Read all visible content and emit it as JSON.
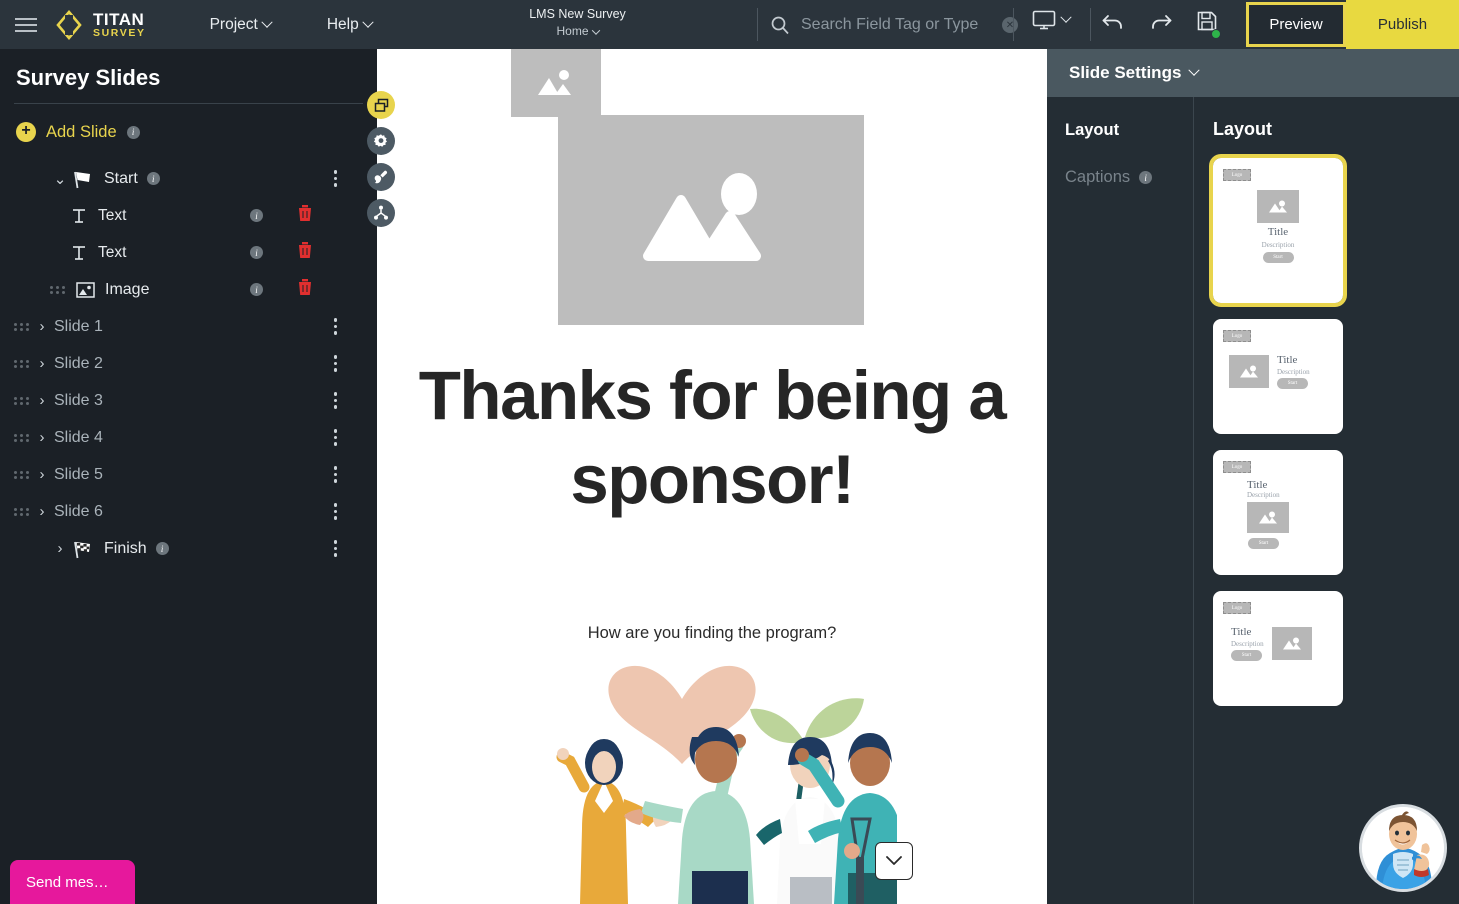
{
  "topbar": {
    "menu_icon": "hamburger-icon",
    "brand_primary": "TITAN",
    "brand_secondary": "SURVEY",
    "menus": [
      {
        "label": "Project"
      },
      {
        "label": "Help"
      }
    ],
    "doc_title": "LMS New Survey",
    "doc_subtitle": "Home",
    "search": {
      "placeholder": "Search Field Tag or Type",
      "value": "",
      "clear_label": "✕"
    },
    "device_icon": "monitor-icon",
    "undo_icon": "undo-icon",
    "redo_icon": "redo-icon",
    "save_icon": "save-icon",
    "preview_label": "Preview",
    "publish_label": "Publish",
    "accent_color": "#e8d44d"
  },
  "sidebar": {
    "title": "Survey Slides",
    "add_slide_label": "Add Slide",
    "info_char": "i",
    "tree": [
      {
        "label": "Start",
        "icon": "flag-icon",
        "expanded": true,
        "info": true
      },
      {
        "label": "Text",
        "icon": "text-icon",
        "child": true,
        "info": true
      },
      {
        "label": "Text",
        "icon": "text-icon",
        "child": true,
        "info": true
      },
      {
        "label": "Image",
        "icon": "image-icon",
        "child": true,
        "info": true
      },
      {
        "label": "Slide 1",
        "icon": "none",
        "expanded": false
      },
      {
        "label": "Slide 2",
        "icon": "none",
        "expanded": false
      },
      {
        "label": "Slide 3",
        "icon": "none",
        "expanded": false
      },
      {
        "label": "Slide 4",
        "icon": "none",
        "expanded": false
      },
      {
        "label": "Slide 5",
        "icon": "none",
        "expanded": false
      },
      {
        "label": "Slide 6",
        "icon": "none",
        "expanded": false
      },
      {
        "label": "Finish",
        "icon": "checkered-flag-icon",
        "expanded": false,
        "info": true
      }
    ],
    "fabs": [
      {
        "name": "duplicate-icon",
        "accent": true
      },
      {
        "name": "gear-icon",
        "accent": false
      },
      {
        "name": "brush-icon",
        "accent": false
      },
      {
        "name": "branch-icon",
        "accent": false
      }
    ],
    "chat_label": "Send mes…",
    "chat_color": "#e6189c"
  },
  "canvas": {
    "logo_placeholder": "image-placeholder",
    "main_placeholder": "image-placeholder",
    "headline": "Thanks for being a sponsor!",
    "subline": "How are you finding the program?",
    "illustration": "people-celebrating-illustration",
    "scroll_down_icon": "chevron-down-icon"
  },
  "right_panel": {
    "header": "Slide Settings",
    "nav": [
      {
        "label": "Layout",
        "active": true,
        "info": false
      },
      {
        "label": "Captions",
        "active": false,
        "info": true
      }
    ],
    "section_title": "Layout",
    "thumbs": [
      {
        "name": "layout-centered",
        "selected": true,
        "logo": "Logo",
        "title": "Title",
        "description": "Description",
        "start": "Start"
      },
      {
        "name": "layout-image-left",
        "selected": false,
        "logo": "Logo",
        "title": "Title",
        "description": "Description",
        "start": "Start"
      },
      {
        "name": "layout-text-above-image",
        "selected": false,
        "logo": "Logo",
        "title": "Title",
        "description": "Description",
        "start": "Start"
      },
      {
        "name": "layout-image-right",
        "selected": false,
        "logo": "Logo",
        "title": "Title",
        "description": "Description",
        "start": "Start"
      }
    ]
  },
  "helper_bot": {
    "name": "support-mascot-avatar"
  }
}
